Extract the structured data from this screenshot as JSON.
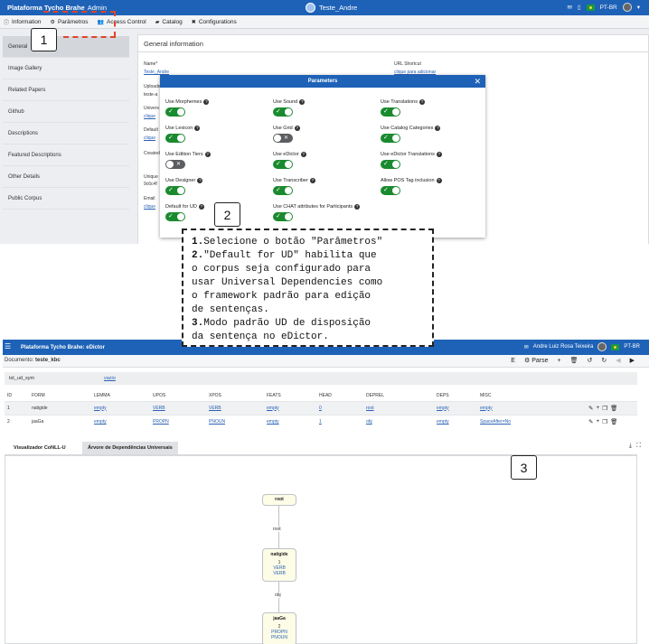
{
  "top": {
    "brand": "Plataforma Tycho Brahe",
    "brand_sub": "Admin",
    "center_title": "Teste_Andre",
    "lang": "PT-BR",
    "tabs": [
      "Information",
      "Parâmetros",
      "Access Control",
      "Catalog",
      "Configurations"
    ],
    "side_items": [
      "General",
      "Image Gallery",
      "Related Papers",
      "Github",
      "Descriptions",
      "Featured Descriptions",
      "Other Details",
      "Public Corpus"
    ],
    "section_title": "General information",
    "fields": {
      "name_label": "Name*",
      "name_value": "Teste_Andre",
      "url_label": "URL Shortcut",
      "url_value": "clique para adicionar",
      "upload_label": "Uploaded",
      "upload_value": "teste-a",
      "univ_label": "Univers",
      "univ_value": "clique",
      "default_label": "Default",
      "default_value": "clique",
      "created_label": "Created",
      "unique_label": "Unique",
      "unique_value": "9c6c4f",
      "email_label": "Email",
      "email_value": "clique"
    }
  },
  "modal": {
    "title": "Parameters",
    "options": [
      {
        "label": "Use Morphemes",
        "on": true
      },
      {
        "label": "Use Sound",
        "on": true
      },
      {
        "label": "Use Translations",
        "on": true
      },
      {
        "label": "Use Lexicon",
        "on": true
      },
      {
        "label": "Use Grid",
        "on": false
      },
      {
        "label": "Use Catalog Categories",
        "on": true
      },
      {
        "label": "Use Edition Tiers",
        "on": false
      },
      {
        "label": "Use eDictor",
        "on": true
      },
      {
        "label": "Use eDictor Translations",
        "on": true
      },
      {
        "label": "Use Designer",
        "on": true
      },
      {
        "label": "Use Transcriber",
        "on": true
      },
      {
        "label": "Allow POS Tag inclusion",
        "on": true
      },
      {
        "label": "Default for UD",
        "on": true
      },
      {
        "label": "Use CHAT attributes for Participants",
        "on": true
      }
    ]
  },
  "markers": {
    "m1": "1",
    "m2": "2",
    "m3": "3"
  },
  "callout": {
    "lines": [
      {
        "num": "1.",
        "text": "Selecione o botão \"Parâmetros\""
      },
      {
        "num": "2.",
        "text": "\"Default for UD\" habilita que"
      },
      {
        "num": "",
        "text": "o corpus seja configurado para"
      },
      {
        "num": "",
        "text": "usar Universal Dependencies como"
      },
      {
        "num": "",
        "text": "o framework padrão para edição"
      },
      {
        "num": "",
        "text": "de sentenças."
      },
      {
        "num": "3.",
        "text": "Modo padrão UD de disposição"
      },
      {
        "num": "",
        "text": "da sentença no eDictor."
      }
    ]
  },
  "bottom": {
    "brand": "Plataforma Tycho Brahe: eDictor",
    "user": "Andre Luiz Rosa Teixeira",
    "lang": "PT-BR",
    "doc_label": "Documento:",
    "doc_name": "teste_kbc",
    "tools": [
      "E",
      "Parse",
      "+",
      "🗑",
      "↺",
      "↻"
    ],
    "sent_id": "tst_ud_sym",
    "sent_value": "vazio",
    "columns": [
      "ID",
      "FORM",
      "LEMMA",
      "UPOS",
      "XPOS",
      "FEATS",
      "HEAD",
      "DEPREL",
      "DEPS",
      "MISC"
    ],
    "rows": [
      [
        "1",
        "natigide",
        "empty",
        "VERB",
        "VERB",
        "empty",
        "0",
        "root",
        "empty",
        "empty"
      ],
      [
        "2",
        "jaaGa",
        "empty",
        "PROPN",
        "PNOUN",
        "empty",
        "1",
        "obj",
        "empty",
        "SpaceAfter=No"
      ]
    ],
    "view_tabs": [
      "Visualizador CoNLL-U",
      "Árvore de Dependências Universais"
    ],
    "tree": {
      "root_label": "root",
      "edge1": "root",
      "node1_word": "natigide",
      "node1_id": "1",
      "node1_upos": "VERB",
      "node1_xpos": "VERB",
      "edge2": "obj",
      "node2_word": "jaaGa",
      "node2_id": "2",
      "node2_upos": "PROPN",
      "node2_xpos": "PNOUN"
    }
  }
}
